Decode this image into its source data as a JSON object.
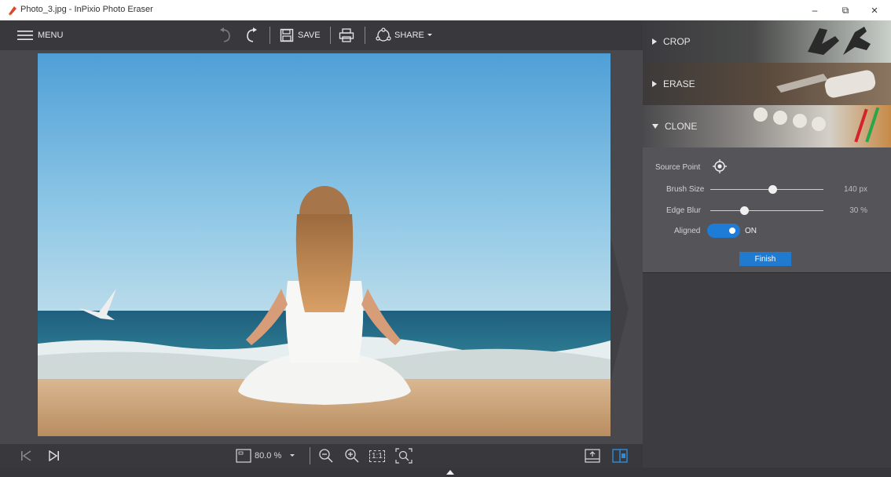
{
  "window": {
    "title": "Photo_3.jpg - InPixio Photo Eraser",
    "minimize_glyph": "–",
    "restore_glyph": "⧉",
    "close_glyph": "×"
  },
  "toolbar": {
    "menu_label": "MENU",
    "save_label": "SAVE",
    "share_label": "SHARE"
  },
  "bottombar": {
    "zoom_value": "80.0 %",
    "actual_size_label": "1:1"
  },
  "panel": {
    "sections": [
      {
        "label": "CROP",
        "state": "collapsed"
      },
      {
        "label": "ERASE",
        "state": "collapsed"
      },
      {
        "label": "CLONE",
        "state": "expanded"
      }
    ],
    "clone": {
      "source_point_label": "Source Point",
      "brush_size_label": "Brush Size",
      "brush_size_value": "140 px",
      "brush_size_fraction": 0.55,
      "edge_blur_label": "Edge Blur",
      "edge_blur_value": "30 %",
      "edge_blur_fraction": 0.3,
      "aligned_label": "Aligned",
      "aligned_state": "ON",
      "finish_label": "Finish"
    }
  },
  "colors": {
    "accent": "#1f7ad0",
    "toolbar": "#39383c",
    "panel": "#555459"
  }
}
